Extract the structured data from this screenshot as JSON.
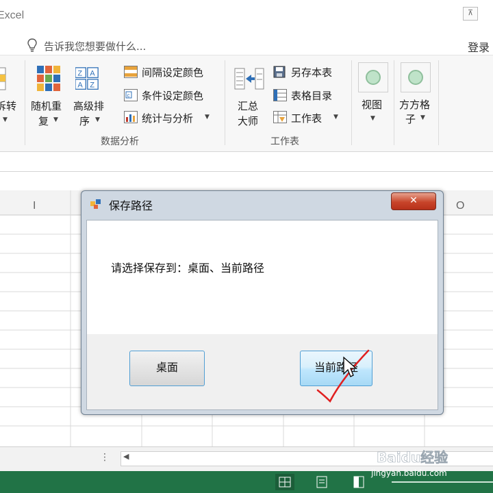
{
  "window": {
    "app_title": "Excel",
    "restore_label": "⊼"
  },
  "tellme": {
    "text": "告诉我您想要做什么...",
    "login_label": "登录"
  },
  "ribbon": {
    "left_partial_label": "拆转",
    "random_reorder": [
      "随机重",
      "复"
    ],
    "advanced_sort": [
      "高级排",
      "序"
    ],
    "interval_color": "间隔设定颜色",
    "conditional_color": "条件设定颜色",
    "stats_analysis": "统计与分析",
    "group_data_analysis": "数据分析",
    "summary_master": [
      "汇总",
      "大师"
    ],
    "save_sheet": "另存本表",
    "sheet_directory": "表格目录",
    "worksheet": "工作表",
    "group_worksheet": "工作表",
    "view_label": "视图",
    "grid_label": [
      "方方格",
      "子"
    ]
  },
  "sheet": {
    "col_i": "I",
    "col_o": "O"
  },
  "dialog": {
    "title": "保存路径",
    "close_label": "✕",
    "message": "请选择保存到：桌面、当前路径",
    "btn_desktop": "桌面",
    "btn_current": "当前路径"
  },
  "watermark": {
    "brand": "Baidu经验",
    "url": "jingyan.baidu.com"
  },
  "colors": {
    "status_bar": "#217346",
    "check_mark": "#e02020",
    "close_button": "#c8452a"
  }
}
